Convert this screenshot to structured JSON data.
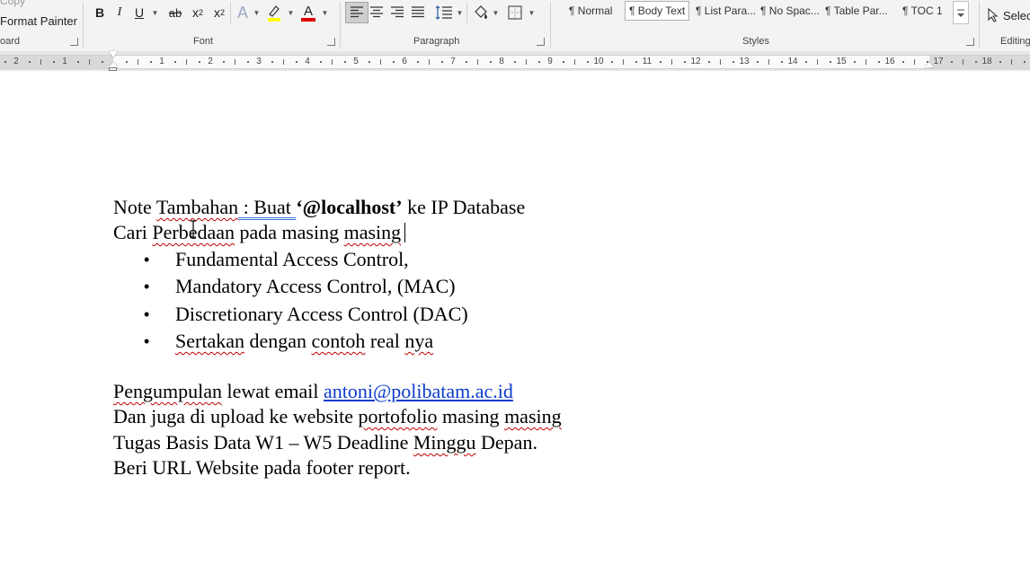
{
  "ribbon": {
    "clipboard": {
      "copy_label": "Copy",
      "format_painter_label": "Format Painter",
      "group_label": "oard"
    },
    "font": {
      "group_label": "Font",
      "bold": "B",
      "italic": "I",
      "underline": "U",
      "strikethrough": "ab",
      "subscript": "x",
      "subscript_mark": "2",
      "superscript": "x",
      "superscript_mark": "2",
      "text_effects": "A",
      "font_color": "A",
      "highlight_color": "#ffff00",
      "font_color_bar": "#e00000"
    },
    "paragraph": {
      "group_label": "Paragraph"
    },
    "styles": {
      "group_label": "Styles",
      "items": [
        "¶ Normal",
        "¶ Body Text",
        "¶ List Para...",
        "¶ No Spac...",
        "¶ Table Par...",
        "¶ TOC 1"
      ],
      "selected_index": 1
    },
    "editing": {
      "group_label": "Editing",
      "select_label": "Selec"
    }
  },
  "ruler": {
    "left_numbers": [
      "2",
      "1"
    ],
    "numbers": [
      "1",
      "2",
      "3",
      "4",
      "5",
      "6",
      "7",
      "8",
      "9",
      "10",
      "11",
      "12",
      "13",
      "14",
      "15",
      "16",
      "17",
      "18"
    ]
  },
  "document": {
    "line1": {
      "part1": "Note ",
      "part2": "Tambahan",
      "part3": " : Buat ",
      "bold": "‘@localhost’",
      "part4": " ke IP Database"
    },
    "line2": {
      "part1": "Cari ",
      "part2": "Perbedaan",
      "part3": " pada masing ",
      "part4": "masing"
    },
    "bullets": [
      {
        "text": "Fundamental Access Control,"
      },
      {
        "text": "Mandatory Access Control, (MAC)"
      },
      {
        "text": "Discretionary Access Control (DAC)"
      },
      {
        "a": "Sertakan",
        "b": " dengan ",
        "c": "contoh",
        "d": " real ",
        "e": "nya"
      }
    ],
    "bullet_glyph": "•",
    "para2": {
      "l1a": "Pengumpulan",
      "l1b": " lewat email ",
      "email": "antoni@polibatam.ac.id",
      "l2a": "Dan juga di upload ke website ",
      "l2b": "portofolio",
      "l2c": " masing ",
      "l2d": "masing",
      "l3a": "Tugas Basis Data W1 – W5 Deadline ",
      "l3b": "Minggu",
      "l3c": " Depan.",
      "l4": "Beri URL Website pada footer report."
    }
  }
}
